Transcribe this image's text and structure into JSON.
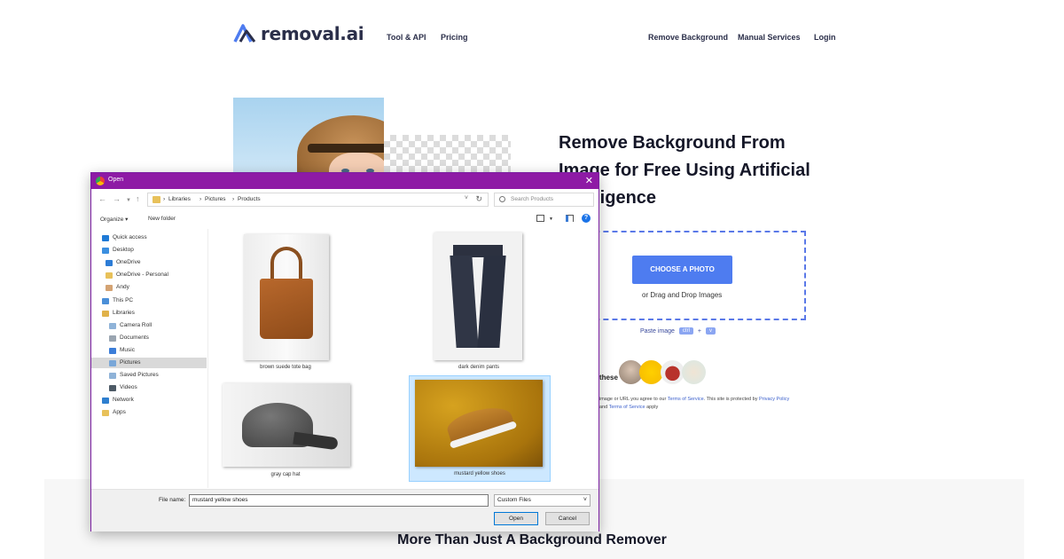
{
  "site": {
    "brand": "removal.ai",
    "nav": {
      "tool_api": "Tool & API",
      "pricing": "Pricing",
      "remove_background": "Remove Background",
      "manual_services": "Manual Services",
      "login": "Login"
    },
    "hero": {
      "headline": "Remove Background From Image for Free Using Artificial Intelligence",
      "choose_photo": "CHOOSE A PHOTO",
      "drag_drop": "or Drag and Drop Images",
      "paste_label": "Paste image",
      "paste_key1": "ctrl",
      "paste_plus": "+",
      "paste_key2": "v",
      "samples_label": "these",
      "legal_prefix": "image or URL you agree to our",
      "terms": "Terms of Service",
      "legal_middle": ". This site is protected by",
      "privacy": "Privacy Policy",
      "and": "and",
      "terms2": "Terms of Service",
      "apply": "apply"
    },
    "section_title": "More Than Just A Background Remover",
    "colors": {
      "brand": "#2b2f4a",
      "accent": "#4e7cf0",
      "dialog_titlebar": "#8e1aa5"
    }
  },
  "dialog": {
    "title": "Open",
    "close": "✕",
    "breadcrumb": [
      "Libraries",
      "Pictures",
      "Products"
    ],
    "search_placeholder": "Search Products",
    "toolbar": {
      "organize": "Organize ▾",
      "new_folder": "New folder"
    },
    "sidebar": [
      {
        "label": "Quick access",
        "icon": "star-icon"
      },
      {
        "label": "Desktop",
        "icon": "desktop-icon"
      },
      {
        "label": "OneDrive",
        "icon": "cloud-icon"
      },
      {
        "label": "OneDrive - Personal",
        "icon": "folder-icon"
      },
      {
        "label": "Andy",
        "icon": "user-icon"
      },
      {
        "label": "This PC",
        "icon": "pc-icon"
      },
      {
        "label": "Libraries",
        "icon": "library-icon"
      },
      {
        "label": "Camera Roll",
        "icon": "library-folder-icon"
      },
      {
        "label": "Documents",
        "icon": "documents-icon"
      },
      {
        "label": "Music",
        "icon": "music-icon"
      },
      {
        "label": "Pictures",
        "icon": "pictures-icon",
        "selected": true
      },
      {
        "label": "Saved Pictures",
        "icon": "library-folder-icon"
      },
      {
        "label": "Videos",
        "icon": "videos-icon"
      },
      {
        "label": "Network",
        "icon": "network-icon"
      },
      {
        "label": "Apps",
        "icon": "folder-icon"
      }
    ],
    "files": [
      {
        "name": "brown suede tote bag"
      },
      {
        "name": "dark denim pants"
      },
      {
        "name": "gray cap hat"
      },
      {
        "name": "mustard yellow shoes",
        "selected": true
      }
    ],
    "file_name_label": "File name:",
    "file_name_value": "mustard yellow shoes",
    "file_type": "Custom Files",
    "open_label": "Open",
    "cancel_label": "Cancel"
  }
}
